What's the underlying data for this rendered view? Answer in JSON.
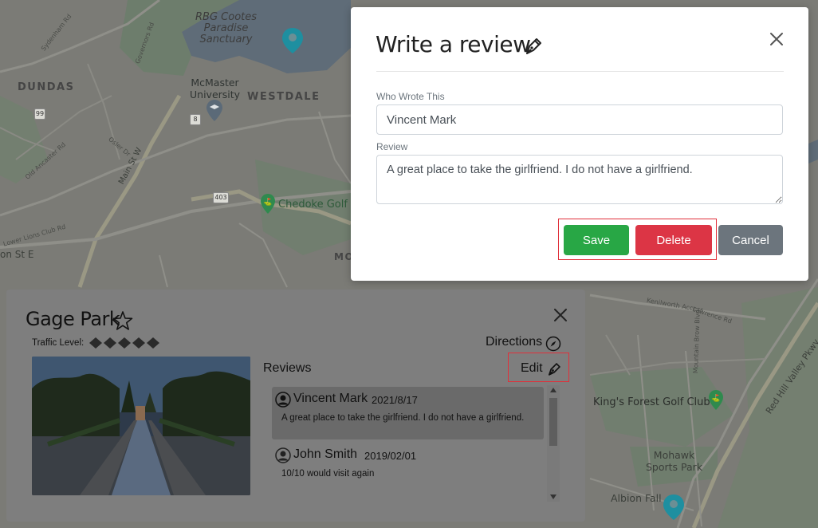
{
  "map": {
    "labels": {
      "rbg": "RBG Cootes\nParadise\nSanctuary",
      "dundas": "DUNDAS",
      "mcmaster": "McMaster\nUniversity",
      "westdale": "WESTDALE",
      "sydenham": "Sydenham Rd",
      "governors": "Governors Rd",
      "main_st": "Main St W",
      "osler": "Osler Dr",
      "old_ancaster": "Old Ancaster Rd",
      "lower_lions": "Lower Lions Club Rd",
      "on_st": "on St E",
      "chedoke": "Chedoke Golf C",
      "kings_forest": "King's Forest Golf Club",
      "mohawk": "Mohawk\nSports Park",
      "albion": "Albion Fall",
      "red_hill": "Red Hill Valley Pkwy",
      "mo": "MO",
      "kenilworth": "Kenilworth Access",
      "lawrence": "Lawrence Rd",
      "mountain_brow": "Mountain Brow Blvd",
      "hwy_99": "99",
      "hwy_8": "8",
      "hwy_403": "403",
      "hwy_8b": "8"
    },
    "colors": {
      "land": "#7b7b76",
      "park": "#6d7d6c",
      "water": "#5f6c78",
      "road": "#8f8f89",
      "major_road": "#9a9884",
      "pin": "#1e8fa0"
    }
  },
  "modal": {
    "title": "Write a review",
    "title_icon": "pen-icon",
    "close_icon": "close-icon",
    "who_label": "Who Wrote This",
    "who_value": "Vincent Mark",
    "review_label": "Review",
    "review_value": "A great place to take the girlfriend. I do not have a girlfriend.",
    "save_label": "Save",
    "delete_label": "Delete",
    "cancel_label": "Cancel",
    "colors": {
      "save": "#28a745",
      "delete": "#dc3545",
      "cancel": "#6c757d",
      "highlight": "#e0303a"
    }
  },
  "place": {
    "name": "Gage Park",
    "favorite_icon": "star-outline-icon",
    "traffic_label": "Traffic Level:",
    "traffic_level": 5,
    "traffic_max": 5,
    "directions_label": "Directions",
    "directions_icon": "compass-icon",
    "reviews_heading": "Reviews",
    "edit_label": "Edit",
    "edit_icon": "pen-icon",
    "reviews": [
      {
        "author": "Vincent Mark",
        "date": "2021/8/17",
        "text": "A great place to take the girlfriend. I do not have a girlfriend.",
        "selected": true
      },
      {
        "author": "John Smith",
        "date": "2019/02/01",
        "text": "10/10 would visit again",
        "selected": false
      }
    ]
  }
}
